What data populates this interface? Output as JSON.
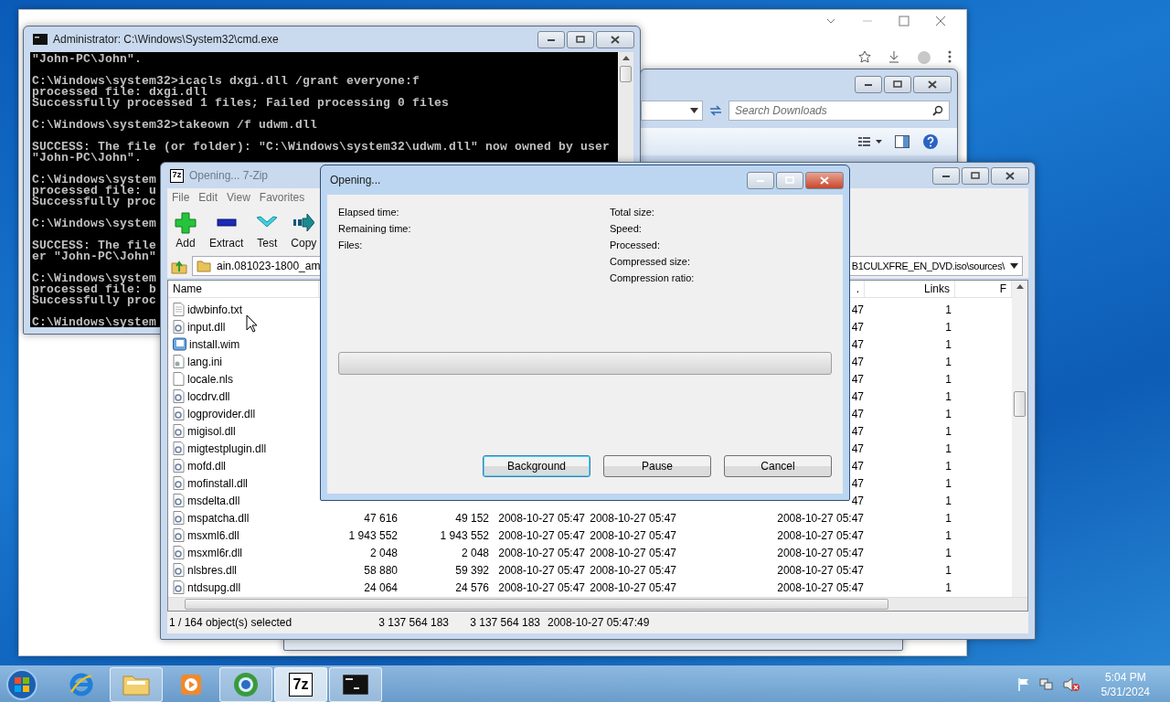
{
  "explorer": {
    "search": {
      "placeholder": "Search Downloads"
    }
  },
  "cmd": {
    "title": "Administrator: C:\\Windows\\System32\\cmd.exe",
    "blocks": [
      [
        "\"John-PC\\John\"."
      ],
      [
        "C:\\Windows\\system32>icacls dxgi.dll /grant everyone:f",
        "processed file: dxgi.dll",
        "Successfully processed 1 files; Failed processing 0 files"
      ],
      [
        "C:\\Windows\\system32>takeown /f udwm.dll"
      ],
      [
        "SUCCESS: The file (or folder): \"C:\\Windows\\system32\\udwm.dll\" now owned by user",
        "\"John-PC\\John\"."
      ],
      [
        "C:\\Windows\\system",
        "processed file: u",
        "Successfully proc"
      ],
      [
        "C:\\Windows\\system"
      ],
      [
        "SUCCESS: The file",
        "er \"John-PC\\John\""
      ],
      [
        "C:\\Windows\\system",
        "processed file: b",
        "Successfully proc"
      ],
      [
        "C:\\Windows\\system"
      ]
    ]
  },
  "sevenzip": {
    "logo": "7z",
    "title": "Opening... 7-Zip",
    "menu": [
      "File",
      "Edit",
      "View",
      "Favorites"
    ],
    "toolbar": [
      {
        "label": "Add",
        "kind": "add"
      },
      {
        "label": "Extract",
        "kind": "extract"
      },
      {
        "label": "Test",
        "kind": "test"
      },
      {
        "label": "Copy",
        "kind": "copy"
      }
    ],
    "address": {
      "left": "ain.081023-1800_am",
      "right": "B1CULXFRE_EN_DVD.iso\\sources\\"
    },
    "columns": {
      "name": "Name",
      "column_7": ".",
      "links": "Links",
      "column_9": "F"
    },
    "rows": [
      {
        "name": "idwbinfo.txt",
        "kind": "text",
        "column_7": "47",
        "links": "1"
      },
      {
        "name": "input.dll",
        "kind": "dll",
        "column_7": "47",
        "links": "1"
      },
      {
        "name": "install.wim",
        "kind": "wim",
        "column_7": "47",
        "links": "1"
      },
      {
        "name": "lang.ini",
        "kind": "ini",
        "column_7": "47",
        "links": "1"
      },
      {
        "name": "locale.nls",
        "kind": "blank",
        "column_7": "47",
        "links": "1"
      },
      {
        "name": "locdrv.dll",
        "kind": "dll",
        "column_7": "47",
        "links": "1"
      },
      {
        "name": "logprovider.dll",
        "kind": "dll",
        "column_7": "47",
        "links": "1"
      },
      {
        "name": "migisol.dll",
        "kind": "dll",
        "column_7": "47",
        "links": "1"
      },
      {
        "name": "migtestplugin.dll",
        "kind": "dll",
        "column_7": "47",
        "links": "1"
      },
      {
        "name": "mofd.dll",
        "kind": "dll",
        "column_7": "47",
        "links": "1"
      },
      {
        "name": "mofinstall.dll",
        "kind": "dll",
        "column_7": "47",
        "links": "1"
      },
      {
        "name": "msdelta.dll",
        "kind": "dll",
        "column_7": "47",
        "links": "1"
      },
      {
        "name": "mspatcha.dll",
        "kind": "dll",
        "size": "47 616",
        "packed": "49 152",
        "modified": "2008-10-27 05:47",
        "created": "2008-10-27 05:47",
        "column_7": "2008-10-27 05:47",
        "links": "1"
      },
      {
        "name": "msxml6.dll",
        "kind": "dll",
        "size": "1 943 552",
        "packed": "1 943 552",
        "modified": "2008-10-27 05:47",
        "created": "2008-10-27 05:47",
        "column_7": "2008-10-27 05:47",
        "links": "1"
      },
      {
        "name": "msxml6r.dll",
        "kind": "dll",
        "size": "2 048",
        "packed": "2 048",
        "modified": "2008-10-27 05:47",
        "created": "2008-10-27 05:47",
        "column_7": "2008-10-27 05:47",
        "links": "1"
      },
      {
        "name": "nlsbres.dll",
        "kind": "dll",
        "size": "58 880",
        "packed": "59 392",
        "modified": "2008-10-27 05:47",
        "created": "2008-10-27 05:47",
        "column_7": "2008-10-27 05:47",
        "links": "1"
      },
      {
        "name": "ntdsupg.dll",
        "kind": "dll",
        "size": "24 064",
        "packed": "24 576",
        "modified": "2008-10-27 05:47",
        "created": "2008-10-27 05:47",
        "column_7": "2008-10-27 05:47",
        "links": "1"
      }
    ],
    "status": [
      "1 / 164 object(s) selected",
      "3 137 564 183",
      "3 137 564 183",
      "2008-10-27 05:47:49"
    ]
  },
  "dialog": {
    "title": "Opening...",
    "left_labels": [
      "Elapsed time:",
      "Remaining time:",
      "Files:"
    ],
    "right_labels": [
      "Total size:",
      "Speed:",
      "Processed:",
      "Compressed size:",
      "Compression ratio:"
    ],
    "progress": {
      "level": 0
    },
    "buttons": [
      {
        "label": "Background",
        "default": true
      },
      {
        "label": "Pause",
        "default": false
      },
      {
        "label": "Cancel",
        "default": false
      }
    ]
  },
  "taskbar": {
    "apps": [
      {
        "kind": "ie",
        "running": false,
        "active": false
      },
      {
        "kind": "folder",
        "running": true,
        "active": false
      },
      {
        "kind": "media",
        "running": false,
        "active": false
      },
      {
        "kind": "globe",
        "running": true,
        "active": false
      },
      {
        "kind": "sevenzip",
        "running": true,
        "active": true,
        "label": "7z"
      },
      {
        "kind": "console",
        "running": true,
        "active": false
      }
    ],
    "clock": {
      "time": "5:04 PM",
      "date": "5/31/2024"
    }
  }
}
